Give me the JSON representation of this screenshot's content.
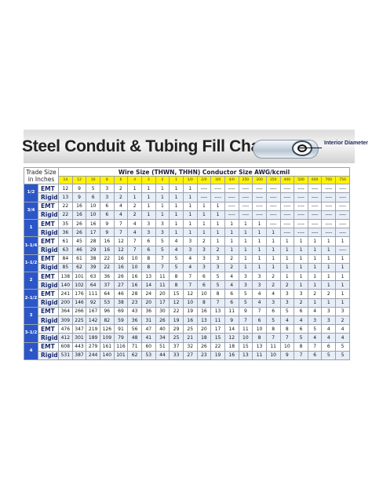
{
  "title": "Steel Conduit & Tubing Fill Chart",
  "diagram_label": "Interior Diameter",
  "corner_label": "Trade Size in Inches",
  "wire_header": "Wire Size (THWN, THHN) Conductor Size AWG/kcmil",
  "wire_sizes": [
    "14",
    "12",
    "10",
    "8",
    "6",
    "4",
    "3",
    "2",
    "1",
    "1/0",
    "2/0",
    "3/0",
    "4/0",
    "250",
    "300",
    "350",
    "400",
    "500",
    "600",
    "700",
    "750"
  ],
  "trade_sizes": [
    "1/2",
    "3/4",
    "1",
    "1-1/4",
    "1-1/2",
    "2",
    "2-1/2",
    "3",
    "3-1/2",
    "4"
  ],
  "rows": [
    {
      "type": "EMT",
      "values": [
        "12",
        "9",
        "5",
        "3",
        "2",
        "1",
        "1",
        "1",
        "1",
        "1",
        "----",
        "----",
        "----",
        "----",
        "----",
        "----",
        "----",
        "----",
        "----",
        "----",
        "----"
      ]
    },
    {
      "type": "Rigid",
      "values": [
        "13",
        "9",
        "6",
        "3",
        "2",
        "1",
        "1",
        "1",
        "1",
        "1",
        "----",
        "----",
        "----",
        "----",
        "----",
        "----",
        "----",
        "----",
        "----",
        "----",
        "----"
      ]
    },
    {
      "type": "EMT",
      "values": [
        "22",
        "16",
        "10",
        "6",
        "4",
        "2",
        "1",
        "1",
        "1",
        "1",
        "1",
        "1",
        "----",
        "----",
        "----",
        "----",
        "----",
        "----",
        "----",
        "----",
        "----"
      ]
    },
    {
      "type": "Rigid",
      "values": [
        "22",
        "16",
        "10",
        "6",
        "4",
        "2",
        "1",
        "1",
        "1",
        "1",
        "1",
        "1",
        "----",
        "----",
        "----",
        "----",
        "----",
        "----",
        "----",
        "----",
        "----"
      ]
    },
    {
      "type": "EMT",
      "values": [
        "35",
        "26",
        "16",
        "9",
        "7",
        "4",
        "3",
        "3",
        "1",
        "1",
        "1",
        "1",
        "1",
        "1",
        "1",
        "----",
        "----",
        "----",
        "----",
        "----",
        "----"
      ]
    },
    {
      "type": "Rigid",
      "values": [
        "36",
        "26",
        "17",
        "9",
        "7",
        "4",
        "3",
        "3",
        "1",
        "1",
        "1",
        "1",
        "1",
        "1",
        "1",
        "1",
        "----",
        "----",
        "----",
        "----",
        "----"
      ]
    },
    {
      "type": "EMT",
      "values": [
        "61",
        "45",
        "28",
        "16",
        "12",
        "7",
        "6",
        "5",
        "4",
        "3",
        "2",
        "1",
        "1",
        "1",
        "1",
        "1",
        "1",
        "1",
        "1",
        "1",
        "1"
      ]
    },
    {
      "type": "Rigid",
      "values": [
        "63",
        "46",
        "29",
        "16",
        "12",
        "7",
        "6",
        "5",
        "4",
        "3",
        "3",
        "2",
        "1",
        "1",
        "1",
        "1",
        "1",
        "1",
        "1",
        "1",
        "----"
      ]
    },
    {
      "type": "EMT",
      "values": [
        "84",
        "61",
        "38",
        "22",
        "16",
        "10",
        "8",
        "7",
        "5",
        "4",
        "3",
        "3",
        "2",
        "1",
        "1",
        "1",
        "1",
        "1",
        "1",
        "1",
        "1"
      ]
    },
    {
      "type": "Rigid",
      "values": [
        "85",
        "62",
        "39",
        "22",
        "16",
        "10",
        "8",
        "7",
        "5",
        "4",
        "3",
        "3",
        "2",
        "1",
        "1",
        "1",
        "1",
        "1",
        "1",
        "1",
        "1"
      ]
    },
    {
      "type": "EMT",
      "values": [
        "138",
        "101",
        "63",
        "36",
        "26",
        "16",
        "13",
        "11",
        "8",
        "7",
        "6",
        "5",
        "4",
        "3",
        "3",
        "2",
        "1",
        "1",
        "1",
        "1",
        "1"
      ]
    },
    {
      "type": "Rigid",
      "values": [
        "140",
        "102",
        "64",
        "37",
        "27",
        "16",
        "14",
        "11",
        "8",
        "7",
        "6",
        "5",
        "4",
        "3",
        "3",
        "2",
        "2",
        "1",
        "1",
        "1",
        "1"
      ]
    },
    {
      "type": "EMT",
      "values": [
        "241",
        "176",
        "111",
        "64",
        "46",
        "28",
        "24",
        "20",
        "15",
        "12",
        "10",
        "8",
        "6",
        "5",
        "4",
        "4",
        "3",
        "3",
        "2",
        "2",
        "1"
      ]
    },
    {
      "type": "Rigid",
      "values": [
        "200",
        "146",
        "92",
        "53",
        "38",
        "23",
        "20",
        "17",
        "12",
        "10",
        "8",
        "7",
        "6",
        "5",
        "4",
        "3",
        "3",
        "2",
        "1",
        "1",
        "1"
      ]
    },
    {
      "type": "EMT",
      "values": [
        "364",
        "266",
        "167",
        "96",
        "69",
        "43",
        "36",
        "30",
        "22",
        "19",
        "16",
        "13",
        "11",
        "9",
        "7",
        "6",
        "5",
        "6",
        "4",
        "3",
        "3"
      ]
    },
    {
      "type": "Rigid",
      "values": [
        "309",
        "225",
        "142",
        "82",
        "59",
        "36",
        "31",
        "26",
        "19",
        "16",
        "13",
        "11",
        "9",
        "7",
        "6",
        "5",
        "4",
        "4",
        "3",
        "3",
        "2"
      ]
    },
    {
      "type": "EMT",
      "values": [
        "476",
        "347",
        "219",
        "126",
        "91",
        "56",
        "47",
        "40",
        "29",
        "25",
        "20",
        "17",
        "14",
        "11",
        "10",
        "8",
        "8",
        "6",
        "5",
        "4",
        "4"
      ]
    },
    {
      "type": "Rigid",
      "values": [
        "412",
        "301",
        "189",
        "109",
        "79",
        "48",
        "41",
        "34",
        "25",
        "21",
        "18",
        "15",
        "12",
        "10",
        "8",
        "7",
        "7",
        "5",
        "4",
        "4",
        "4"
      ]
    },
    {
      "type": "EMT",
      "values": [
        "608",
        "443",
        "279",
        "161",
        "116",
        "71",
        "60",
        "51",
        "37",
        "32",
        "26",
        "22",
        "18",
        "15",
        "13",
        "11",
        "10",
        "8",
        "7",
        "6",
        "5"
      ]
    },
    {
      "type": "Rigid",
      "values": [
        "531",
        "387",
        "244",
        "140",
        "101",
        "62",
        "53",
        "44",
        "33",
        "27",
        "23",
        "19",
        "16",
        "13",
        "11",
        "10",
        "9",
        "7",
        "6",
        "5",
        "5"
      ]
    }
  ]
}
